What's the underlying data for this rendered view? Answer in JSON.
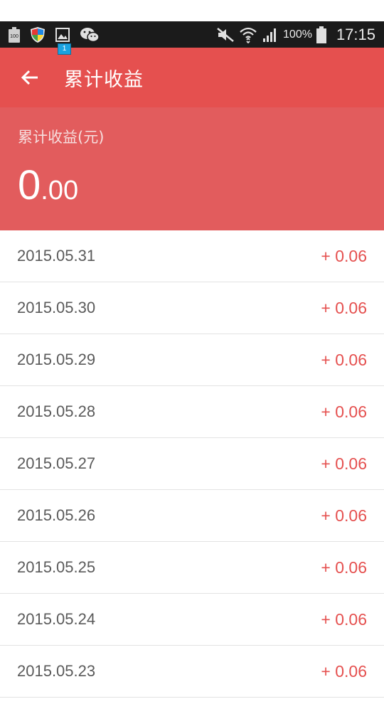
{
  "status_bar": {
    "battery_icon_text": "100",
    "notification_badge": "1",
    "battery_percent": "100%",
    "time": "17:15",
    "icons": [
      "battery-saver-icon",
      "shield-icon",
      "gallery-icon",
      "wechat-icon",
      "mute-icon",
      "wifi-icon",
      "signal-icon",
      "battery-icon"
    ]
  },
  "app_bar": {
    "title": "累计收益",
    "back_icon": "arrow-left-icon"
  },
  "summary": {
    "label": "累计收益(元)",
    "amount_int": "0",
    "amount_dec": ".00"
  },
  "records": [
    {
      "date": "2015.05.31",
      "amount": "+ 0.06"
    },
    {
      "date": "2015.05.30",
      "amount": "+ 0.06"
    },
    {
      "date": "2015.05.29",
      "amount": "+ 0.06"
    },
    {
      "date": "2015.05.28",
      "amount": "+ 0.06"
    },
    {
      "date": "2015.05.27",
      "amount": "+ 0.06"
    },
    {
      "date": "2015.05.26",
      "amount": "+ 0.06"
    },
    {
      "date": "2015.05.25",
      "amount": "+ 0.06"
    },
    {
      "date": "2015.05.24",
      "amount": "+ 0.06"
    },
    {
      "date": "2015.05.23",
      "amount": "+ 0.06"
    }
  ],
  "colors": {
    "app_bar": "#e5504f",
    "summary_bg": "#e25c5d",
    "amount_text": "#e5504f",
    "status_bar": "#1b1b1b"
  }
}
